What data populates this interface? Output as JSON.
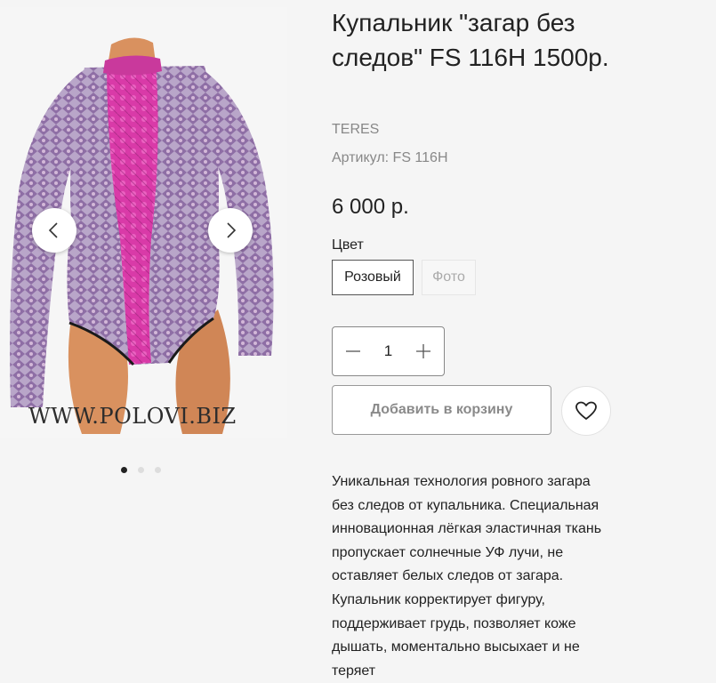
{
  "product": {
    "title": "Купальник \"загар без следов\" FS 116H 1500р.",
    "brand": "TERES",
    "sku": "Артикул: FS 116H",
    "price": "6 000 р."
  },
  "gallery": {
    "watermark": "WWW.POLOVI.BIZ",
    "prev_icon": "chevron-left-icon",
    "next_icon": "chevron-right-icon",
    "dots_total": 3,
    "active_dot": 1
  },
  "options": {
    "color_label": "Цвет",
    "swatches": [
      "Розовый",
      "Фото"
    ],
    "selected": "Розовый"
  },
  "quantity": {
    "value": "1",
    "minus_icon": "minus-icon",
    "plus_icon": "plus-icon"
  },
  "actions": {
    "add_to_cart": "Добавить в корзину",
    "favorite_icon": "heart-icon"
  },
  "description": "Уникальная технология ровного загара без следов от купальника. Специальная инновационная лёгкая эластичная ткань пропускает солнечные УФ лучи, не оставляет белых следов от загара. Купальник корректирует фигуру, поддерживает грудь, позволяет коже дышать, моментально высыхает и не теряет",
  "colors": {
    "accent_pink": "#d93aa8",
    "purple": "#8a3fb5",
    "mannequin": "#d9915f"
  }
}
